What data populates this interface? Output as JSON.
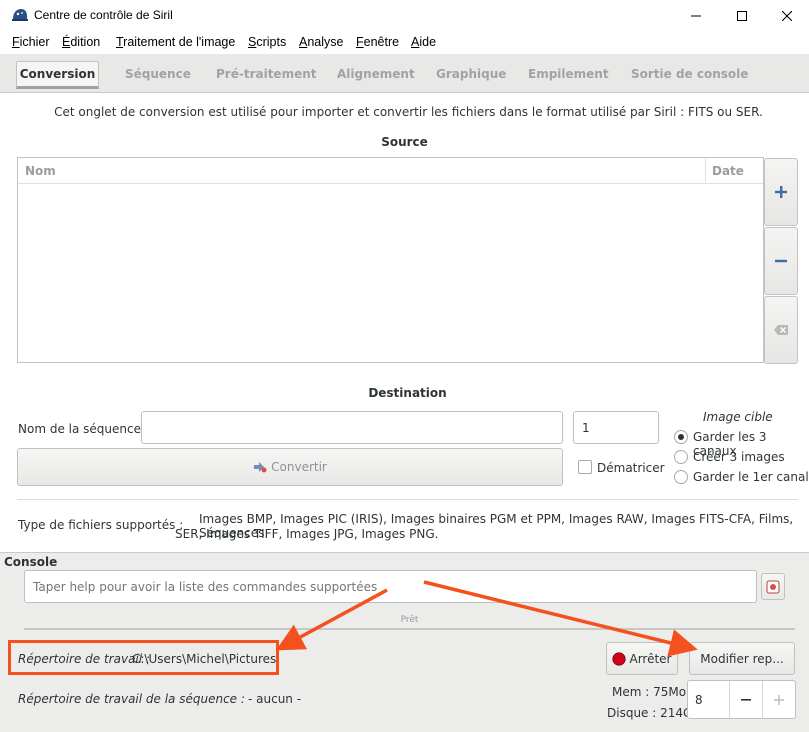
{
  "window": {
    "title": "Centre de contrôle de Siril"
  },
  "menu": {
    "items": [
      "Fichier",
      "Édition",
      "Traitement de l'image",
      "Scripts",
      "Analyse",
      "Fenêtre",
      "Aide"
    ]
  },
  "tabs": {
    "active": "Conversion",
    "items": [
      "Séquence",
      "Pré-traitement",
      "Alignement",
      "Graphique",
      "Empilement",
      "Sortie de console"
    ]
  },
  "conversion": {
    "hint": "Cet onglet de conversion est utilisé pour importer et convertir les fichiers dans le format utilisé par Siril : FITS ou SER.",
    "source_title": "Source",
    "columns": {
      "name": "Nom",
      "date": "Date"
    },
    "destination_title": "Destination",
    "sequence_name_label": "Nom de la séquence :",
    "sequence_name_value": "",
    "start_index": "1",
    "convert_label": "Convertir",
    "demosaic_label": "Dématricer",
    "target_title": "Image cible",
    "target_options": [
      "Garder les 3 canaux",
      "Créer 3 images",
      "Garder le 1er canal"
    ],
    "target_selected": 0,
    "supported_label": "Type de fichiers supportés :",
    "supported_text_line1": "Images BMP, Images PIC (IRIS), Images binaires PGM et PPM, Images RAW, Images FITS-CFA, Films, Séquences",
    "supported_text_line2": "SER, Images TIFF, Images JPG, Images PNG."
  },
  "console": {
    "title": "Console",
    "placeholder": "Taper help pour avoir la liste des commandes supportées",
    "progress_text": "Prêt",
    "progress_fraction": 0
  },
  "status": {
    "workdir_label": "Répertoire de travail :",
    "workdir_value": "C:\\Users\\Michel\\Pictures",
    "seq_workdir_label": "Répertoire de travail de la séquence :",
    "seq_workdir_value": "- aucun -",
    "stop_label": "Arrêter",
    "change_dir_label": "Modifier rep...",
    "mem": "Mem : 75Mo",
    "disk": "Disque : 214G",
    "threads": "8"
  },
  "colors": {
    "annotation": "#f4511e",
    "accent_blue": "#3b6ea8",
    "stop_red": "#d0021b"
  },
  "icons": {
    "app": "siril-icon",
    "add": "plus-icon",
    "remove": "minus-icon",
    "clear": "clear-icon",
    "convert": "convert-icon",
    "script": "script-icon",
    "stop": "stop-icon"
  }
}
